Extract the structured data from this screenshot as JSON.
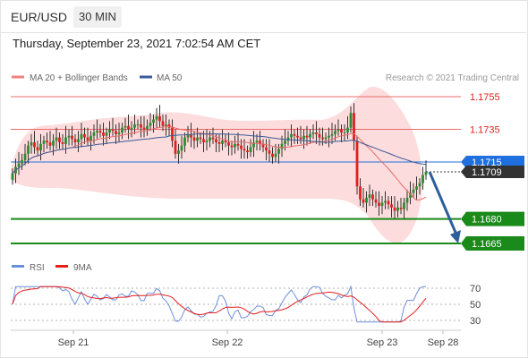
{
  "header": {
    "symbol": "EUR/USD",
    "timeframe": "30 MIN",
    "timestamp": "Thursday, September 23, 2021 7:02:54 AM CET"
  },
  "legend": {
    "ma20_label": "MA 20 + Bollinger Bands",
    "ma50_label": "MA 50",
    "credit": "Research © 2021 Trading Central",
    "rsi_label": "RSI",
    "rsi_ma_label": "9MA"
  },
  "colors": {
    "resistance": "#e86b6b",
    "support": "#1a8a1a",
    "current": "#1f6fde",
    "last": "#333333",
    "band": "#fbd6d6",
    "ma50": "#3a5a99",
    "arrow": "#2d5e9c",
    "rsi": "#6c8fd9",
    "rsi_ma": "#e61e1e",
    "candle_up": "#2e8b2e",
    "candle_down": "#e02020"
  },
  "chart_data": [
    {
      "type": "candlestick",
      "x_labels": [
        "Sep 21",
        "Sep 22",
        "Sep 23",
        "Sep 28"
      ],
      "ylim": [
        1.166,
        1.176
      ],
      "levels": [
        {
          "value": "1.1755",
          "role": "resistance"
        },
        {
          "value": "1.1735",
          "role": "resistance"
        },
        {
          "value": "1.1715",
          "role": "current"
        },
        {
          "value": "1.1709",
          "role": "last"
        },
        {
          "value": "1.1680",
          "role": "support"
        },
        {
          "value": "1.1665",
          "role": "support"
        }
      ],
      "close": [
        1.1708,
        1.1712,
        1.1714,
        1.1716,
        1.172,
        1.1725,
        1.1727,
        1.1724,
        1.1722,
        1.1726,
        1.1728,
        1.1727,
        1.1725,
        1.1728,
        1.173,
        1.1727,
        1.1726,
        1.173,
        1.1731,
        1.1729,
        1.1727,
        1.1729,
        1.1732,
        1.173,
        1.1728,
        1.1731,
        1.1733,
        1.1734,
        1.1733,
        1.1731,
        1.1733,
        1.1735,
        1.1734,
        1.1732,
        1.1733,
        1.1736,
        1.1737,
        1.1735,
        1.1736,
        1.1738,
        1.1738,
        1.1736,
        1.1735,
        1.1737,
        1.1739,
        1.1741,
        1.1743,
        1.174,
        1.1737,
        1.1738,
        1.1736,
        1.1728,
        1.172,
        1.1722,
        1.1725,
        1.173,
        1.1732,
        1.173,
        1.1728,
        1.173,
        1.1729,
        1.1727,
        1.1728,
        1.173,
        1.1729,
        1.1727,
        1.1726,
        1.1728,
        1.1727,
        1.1725,
        1.1724,
        1.1726,
        1.1725,
        1.1723,
        1.1722,
        1.1721,
        1.1724,
        1.1727,
        1.1728,
        1.1726,
        1.1724,
        1.1722,
        1.172,
        1.1718,
        1.172,
        1.1723,
        1.1726,
        1.1728,
        1.173,
        1.1732,
        1.1731,
        1.173,
        1.1729,
        1.1731,
        1.173,
        1.1732,
        1.1733,
        1.1732,
        1.173,
        1.1729,
        1.173,
        1.1731,
        1.1732,
        1.1734,
        1.1735,
        1.1733,
        1.1733,
        1.1736,
        1.1745,
        1.1728,
        1.17,
        1.1692,
        1.169,
        1.1693,
        1.1695,
        1.1692,
        1.169,
        1.1688,
        1.169,
        1.1691,
        1.1689,
        1.1687,
        1.1685,
        1.1687,
        1.1686,
        1.169,
        1.1693,
        1.1696,
        1.1698,
        1.17,
        1.1702,
        1.1707,
        1.1709
      ]
    },
    {
      "type": "line",
      "title": "RSI",
      "ylim": [
        25,
        80
      ],
      "y_ticks": [
        70,
        50,
        30
      ],
      "x_labels": [
        "Sep 21",
        "Sep 22",
        "Sep 23",
        "Sep 28"
      ],
      "series": [
        {
          "name": "RSI"
        },
        {
          "name": "9MA"
        }
      ]
    }
  ]
}
